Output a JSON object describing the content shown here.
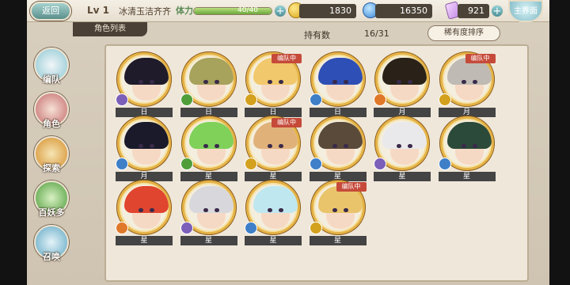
{
  "topbar": {
    "back_label": "返回",
    "level": "Lv 1",
    "player_name": "冰清玉洁齐齐",
    "stamina_label": "体力",
    "stamina_text": "40/40",
    "stamina_fraction": 1.0,
    "coins": "1830",
    "spirit": "16350",
    "cards": "921",
    "main_label": "主界面"
  },
  "subheader": {
    "tab_label": "角色列表",
    "owned_label": "持有数",
    "owned_count": "16/31",
    "sort_label": "稀有度排序"
  },
  "nav": [
    {
      "label": "编队"
    },
    {
      "label": "角色"
    },
    {
      "label": "探索"
    },
    {
      "label": "百妖多"
    },
    {
      "label": "召唤"
    }
  ],
  "badge_text": "编队中",
  "characters": [
    {
      "rarity": "日",
      "hair": "#1f1b2a",
      "attr": "purple",
      "badge": false
    },
    {
      "rarity": "日",
      "hair": "#a7a25c",
      "attr": "green",
      "badge": false
    },
    {
      "rarity": "日",
      "hair": "#f1c86b",
      "attr": "gold",
      "badge": true
    },
    {
      "rarity": "日",
      "hair": "#2e4fb5",
      "attr": "blue",
      "badge": false
    },
    {
      "rarity": "月",
      "hair": "#2a2218",
      "attr": "orange",
      "badge": false
    },
    {
      "rarity": "月",
      "hair": "#bfbab4",
      "attr": "gold",
      "badge": true
    },
    {
      "rarity": "月",
      "hair": "#1a1a2a",
      "attr": "blue",
      "badge": false
    },
    {
      "rarity": "星",
      "hair": "#7fd15a",
      "attr": "green",
      "badge": false
    },
    {
      "rarity": "星",
      "hair": "#e0b27a",
      "attr": "gold",
      "badge": true
    },
    {
      "rarity": "星",
      "hair": "#5a4a3a",
      "attr": "blue",
      "badge": false
    },
    {
      "rarity": "星",
      "hair": "#e9e9ec",
      "attr": "purple",
      "badge": false
    },
    {
      "rarity": "星",
      "hair": "#2c4a3a",
      "attr": "blue",
      "badge": false
    },
    {
      "rarity": "星",
      "hair": "#e0452f",
      "attr": "orange",
      "badge": false
    },
    {
      "rarity": "星",
      "hair": "#d8d8dc",
      "attr": "purple",
      "badge": false
    },
    {
      "rarity": "星",
      "hair": "#bfe7ef",
      "attr": "blue",
      "badge": false
    },
    {
      "rarity": "星",
      "hair": "#e9c46b",
      "attr": "gold",
      "badge": true
    }
  ],
  "colors": {
    "attr_purple": "#7b5fb8",
    "attr_green": "#4f9e3a",
    "attr_gold": "#d3a11e",
    "attr_blue": "#3e7fc8",
    "attr_orange": "#e0782a",
    "frame_gold": "#e5b347",
    "badge_red": "#c64a3a"
  }
}
